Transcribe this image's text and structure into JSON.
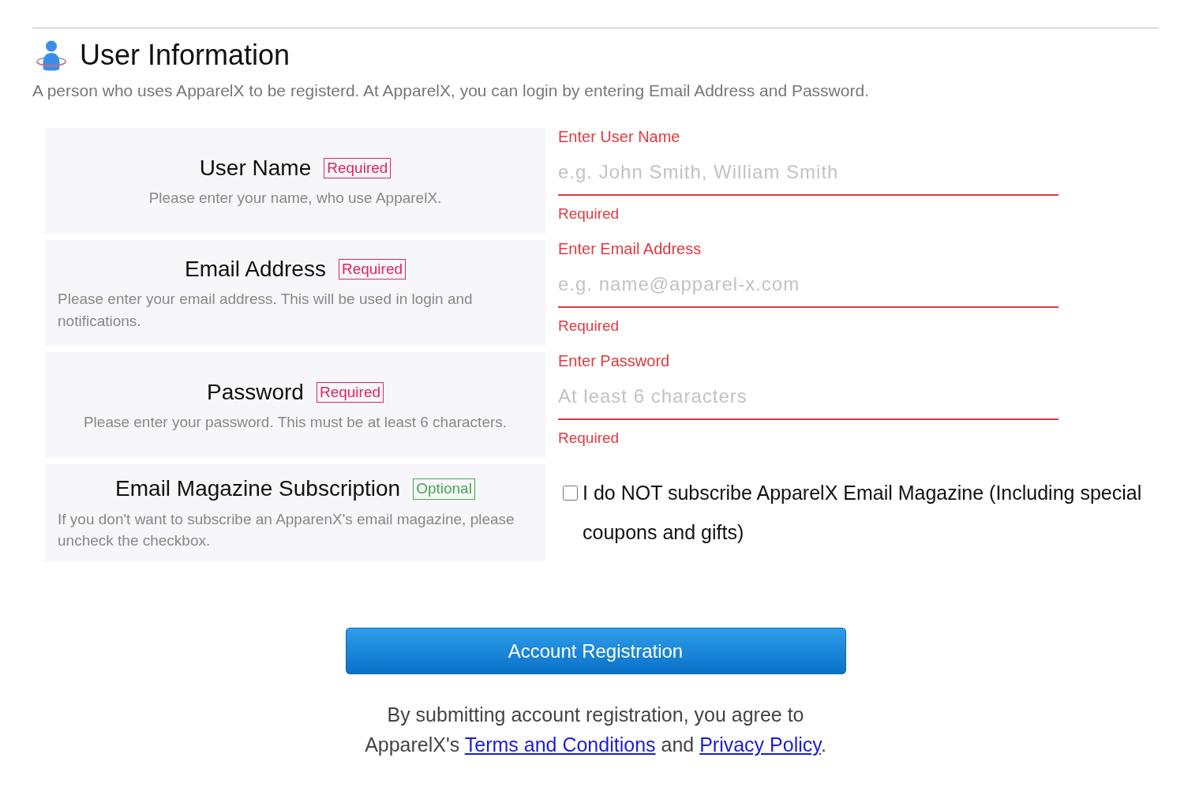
{
  "section": {
    "title": "User Information",
    "description": "A person who uses ApparelX to be registerd. At ApparelX, you can login by entering Email Address and Password."
  },
  "fields": [
    {
      "kind": "input",
      "title": "User Name",
      "badge": {
        "text": "Required",
        "kind": "required"
      },
      "help": "Please enter your name, who use ApparelX.",
      "input": {
        "label": "Enter User Name",
        "placeholder": "e.g. John Smith, William Smith",
        "invalid": true,
        "error": "Required"
      }
    },
    {
      "kind": "input",
      "title": "Email Address",
      "badge": {
        "text": "Required",
        "kind": "required"
      },
      "help": "Please enter your email address. This will be used in login and notifications.",
      "input": {
        "label": "Enter Email Address",
        "placeholder": "e.g. name@apparel-x.com",
        "invalid": true,
        "error": "Required"
      }
    },
    {
      "kind": "input",
      "title": "Password",
      "badge": {
        "text": "Required",
        "kind": "required"
      },
      "help": "Please enter your password. This must be at least 6 characters.",
      "input": {
        "label": "Enter Password",
        "placeholder": "At least 6 characters",
        "invalid": true,
        "error": "Required"
      }
    },
    {
      "kind": "checkbox",
      "title": "Email Magazine Subscription",
      "badge": {
        "text": "Optional",
        "kind": "optional"
      },
      "help": "If you don't want to subscribe an ApparenX's email magazine, please uncheck the checkbox.",
      "checkbox": {
        "label": "I do NOT subscribe ApparelX Email Magazine (Including special coupons and gifts)",
        "checked": false
      }
    }
  ],
  "submit_button": "Account Registration",
  "agreement": [
    {
      "kind": "text",
      "text": "By submitting account registration, you agree to ApparelX's "
    },
    {
      "kind": "link",
      "text": "Terms and Conditions"
    },
    {
      "kind": "text",
      "text": " and "
    },
    {
      "kind": "link",
      "text": "Privacy Policy"
    },
    {
      "kind": "text",
      "text": "."
    }
  ]
}
